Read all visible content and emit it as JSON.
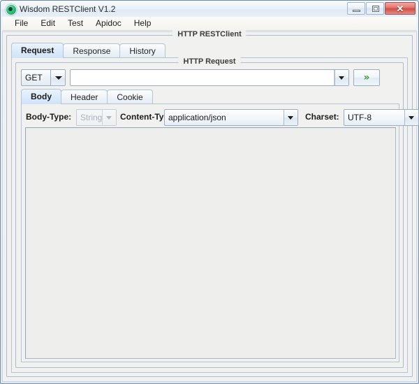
{
  "window": {
    "title": "Wisdom RESTClient V1.2",
    "app_icon": "green-circle-icon",
    "controls": {
      "minimize": "minimize-icon",
      "maximize": "maximize-icon",
      "close": "✕"
    }
  },
  "menubar": {
    "items": [
      {
        "label": "File"
      },
      {
        "label": "Edit"
      },
      {
        "label": "Test"
      },
      {
        "label": "Apidoc"
      },
      {
        "label": "Help"
      }
    ]
  },
  "outer_panel": {
    "title": "HTTP RESTClient"
  },
  "main_tabs": [
    {
      "label": "Request",
      "selected": true
    },
    {
      "label": "Response",
      "selected": false
    },
    {
      "label": "History",
      "selected": false
    }
  ],
  "request_panel": {
    "title": "HTTP Request",
    "method": {
      "value": "GET",
      "arrow_icon": "chevron-down-icon"
    },
    "url": {
      "value": "",
      "placeholder": "",
      "arrow_icon": "chevron-down-icon"
    },
    "send_button": {
      "label": "»",
      "icon": "double-chevron-right-icon",
      "color": "#3c9a32"
    }
  },
  "sub_tabs": [
    {
      "label": "Body",
      "selected": true
    },
    {
      "label": "Header",
      "selected": false
    },
    {
      "label": "Cookie",
      "selected": false
    }
  ],
  "body_options": {
    "body_type": {
      "label": "Body-Type:",
      "value": "String",
      "disabled": true,
      "arrow_icon": "chevron-down-icon"
    },
    "content_type": {
      "label": "Content-Type:",
      "value": "application/json",
      "disabled": false,
      "arrow_icon": "chevron-down-icon"
    },
    "charset": {
      "label": "Charset:",
      "value": "UTF-8",
      "disabled": false,
      "arrow_icon": "chevron-down-icon"
    }
  },
  "body_editor": {
    "value": ""
  }
}
